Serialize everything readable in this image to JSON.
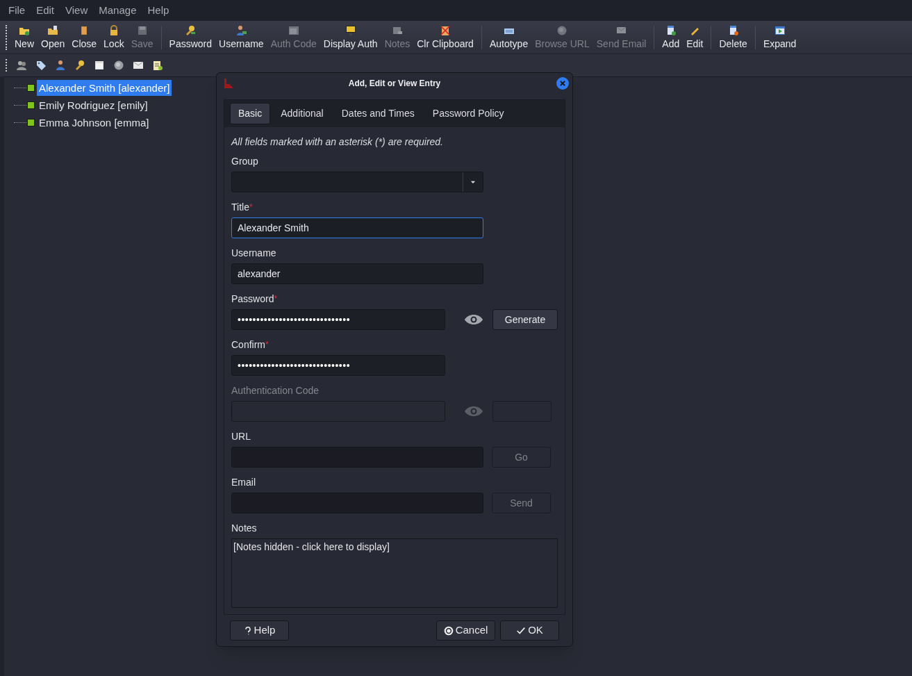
{
  "menu": [
    "File",
    "Edit",
    "View",
    "Manage",
    "Help"
  ],
  "toolbar": [
    {
      "kind": "button",
      "label": "New",
      "disabled": false
    },
    {
      "kind": "button",
      "label": "Open",
      "disabled": false
    },
    {
      "kind": "button",
      "label": "Close",
      "disabled": false
    },
    {
      "kind": "button",
      "label": "Lock",
      "disabled": false
    },
    {
      "kind": "button",
      "label": "Save",
      "disabled": true
    },
    {
      "kind": "separator"
    },
    {
      "kind": "button",
      "label": "Password",
      "disabled": false
    },
    {
      "kind": "button",
      "label": "Username",
      "disabled": false
    },
    {
      "kind": "button",
      "label": "Auth Code",
      "disabled": true
    },
    {
      "kind": "button",
      "label": "Display Auth",
      "disabled": false
    },
    {
      "kind": "button",
      "label": "Notes",
      "disabled": true
    },
    {
      "kind": "button",
      "label": "Clr Clipboard",
      "disabled": false
    },
    {
      "kind": "separator"
    },
    {
      "kind": "button",
      "label": "Autotype",
      "disabled": false
    },
    {
      "kind": "button",
      "label": "Browse URL",
      "disabled": true
    },
    {
      "kind": "button",
      "label": "Send Email",
      "disabled": true
    },
    {
      "kind": "separator"
    },
    {
      "kind": "button",
      "label": "Add",
      "disabled": false
    },
    {
      "kind": "button",
      "label": "Edit",
      "disabled": false
    },
    {
      "kind": "separator"
    },
    {
      "kind": "button",
      "label": "Delete",
      "disabled": false
    },
    {
      "kind": "separator"
    },
    {
      "kind": "button",
      "label": "Expand",
      "disabled": false
    }
  ],
  "tree": [
    {
      "label": "Alexander Smith [alexander]",
      "selected": true,
      "color": "#7fc31c"
    },
    {
      "label": "Emily Rodriguez [emily]",
      "selected": false,
      "color": "#7fc31c"
    },
    {
      "label": "Emma Johnson [emma]",
      "selected": false,
      "color": "#7fc31c"
    }
  ],
  "dialog": {
    "title": "Add, Edit or View Entry",
    "tabs": [
      {
        "label": "Basic",
        "selected": true
      },
      {
        "label": "Additional",
        "selected": false
      },
      {
        "label": "Dates and Times",
        "selected": false
      },
      {
        "label": "Password Policy",
        "selected": false
      }
    ],
    "note": "All fields marked with an asterisk (*) are required.",
    "required_mark": "*",
    "fields": [
      {
        "kind": "combo",
        "label": "Group",
        "required": false
      },
      {
        "kind": "text",
        "label": "Title",
        "required": true,
        "value": "Alexander Smith",
        "focused": true
      },
      {
        "kind": "text",
        "label": "Username",
        "required": false,
        "value": "alexander",
        "focused": false
      },
      {
        "kind": "secret",
        "label": "Password",
        "required": true,
        "value": "••••••••••••••••••••••••••••••",
        "reveal": true,
        "button": "Generate",
        "disabled": false
      },
      {
        "kind": "secret",
        "label": "Confirm",
        "required": true,
        "value": "••••••••••••••••••••••••••••••",
        "reveal": false,
        "disabled": false
      },
      {
        "kind": "secret",
        "label": "Authentication Code",
        "required": false,
        "reveal": true,
        "disabled": true
      },
      {
        "kind": "action",
        "label": "URL",
        "required": false,
        "button": "Go"
      },
      {
        "kind": "action",
        "label": "Email",
        "required": false,
        "button": "Send"
      },
      {
        "kind": "notes",
        "label": "Notes",
        "required": false,
        "value": "[Notes hidden - click here to display]"
      }
    ],
    "buttons": [
      {
        "kind": "help",
        "label": "Help"
      },
      {
        "kind": "cancel",
        "label": "Cancel"
      },
      {
        "kind": "ok",
        "label": "OK"
      }
    ]
  }
}
